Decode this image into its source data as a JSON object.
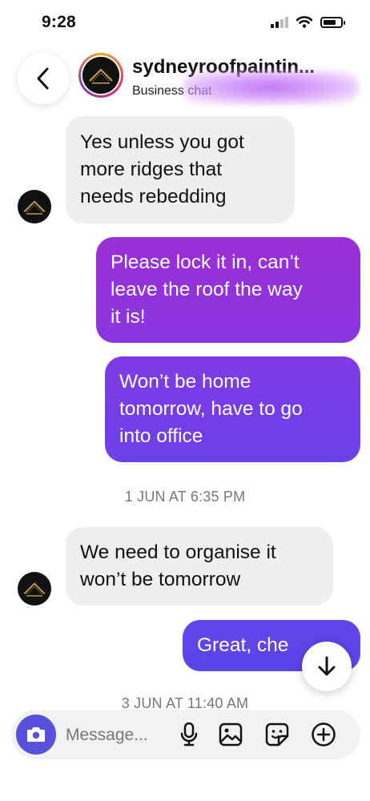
{
  "status_bar": {
    "time": "9:28"
  },
  "header": {
    "name": "sydneyroofpaintin...",
    "subtitle": "Business chat"
  },
  "messages": [
    {
      "direction": "received",
      "text_lines": [
        "Yes unless you got",
        "more ridges that",
        "needs rebedding"
      ]
    },
    {
      "direction": "sent",
      "text_lines": [
        "Please lock it in, can’t",
        "leave the roof the way",
        "it is!"
      ]
    },
    {
      "direction": "sent",
      "text_lines": [
        "Won’t be home",
        "tomorrow, have to go",
        "into office"
      ]
    },
    {
      "direction": "timestamp",
      "text": "1 JUN AT 6:35 PM"
    },
    {
      "direction": "received",
      "text_lines": [
        "We need to organise it",
        "won’t be tomorrow"
      ]
    },
    {
      "direction": "sent",
      "text_lines": [
        "Great, che"
      ]
    },
    {
      "direction": "timestamp",
      "text": "3 JUN AT 11:40 AM"
    }
  ],
  "composer": {
    "placeholder": "Message...",
    "icons": [
      "camera-icon",
      "microphone-icon",
      "gallery-icon",
      "sticker-icon",
      "plus-icon"
    ]
  },
  "colors": {
    "received_bubble": "#efefef",
    "sent_gradient_top": "#9b2fd6",
    "sent_gradient_bottom": "#5b45e8",
    "camera_button": "#5851db"
  }
}
